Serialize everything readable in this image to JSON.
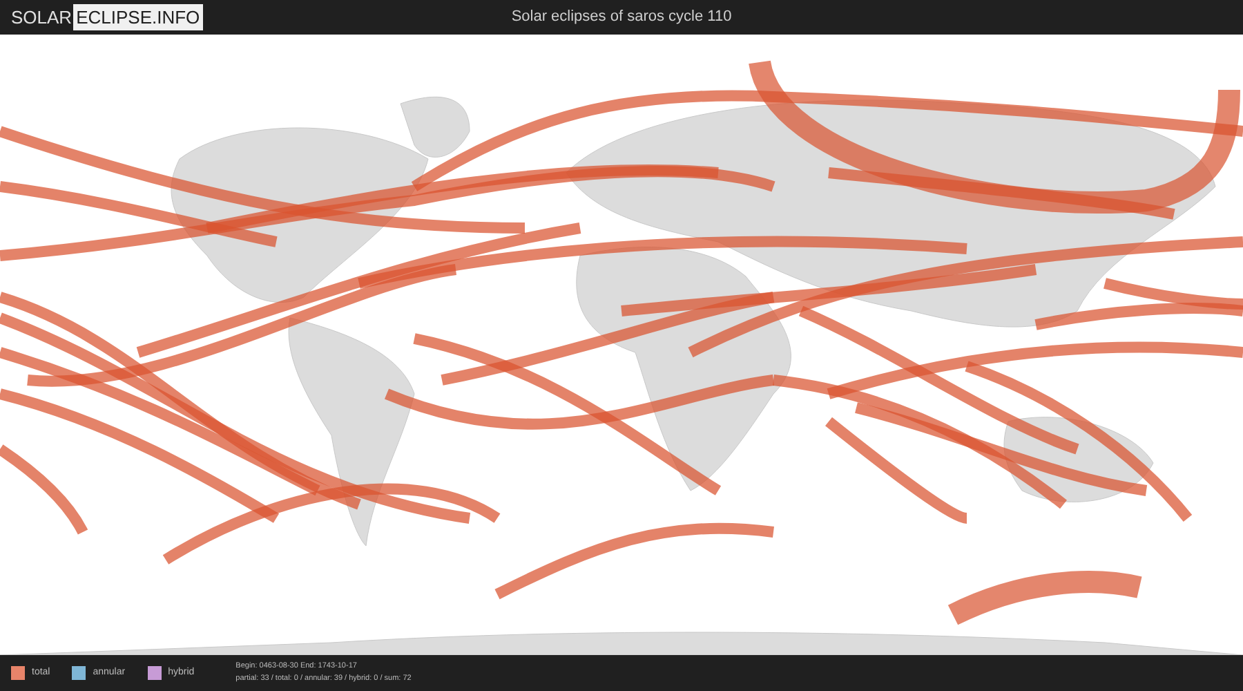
{
  "header": {
    "logo_left": "SOLAR",
    "logo_right": "ECLIPSE.INFO",
    "title": "Solar eclipses of saros cycle 110"
  },
  "legend": [
    {
      "label": "total",
      "color": "#e8846a"
    },
    {
      "label": "annular",
      "color": "#7fb6d6"
    },
    {
      "label": "hybrid",
      "color": "#c79bd6"
    }
  ],
  "summary": {
    "range": "Begin: 0463-08-30 End: 1743-10-17",
    "counts": "partial: 33 / total: 0 / annular: 39 / hybrid: 0 / sum: 72"
  }
}
